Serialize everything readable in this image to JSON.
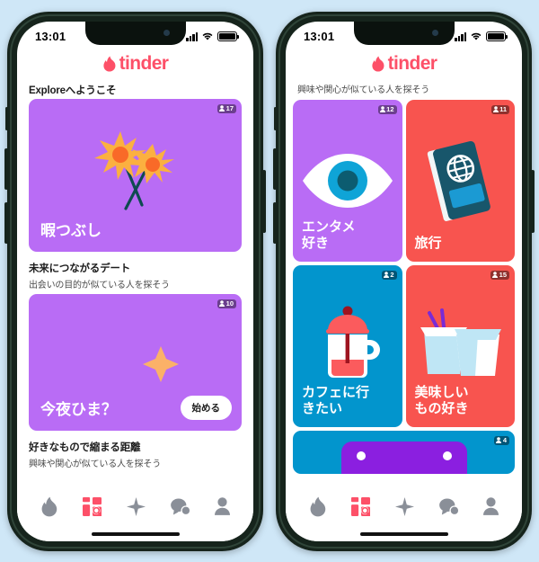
{
  "app": {
    "brand_name": "tinder",
    "brand_color": "#FD5068",
    "flame_icon": "flame-icon"
  },
  "colors": {
    "purple": "#B96CF5",
    "red": "#F8544F",
    "blue": "#0295CD",
    "page_background": "#cfe7f7",
    "active_tab": "#FD5068",
    "inactive_tab": "#8a8f98"
  },
  "status_bar": {
    "time": "13:01",
    "signal_icon": "cellular-signal-icon",
    "wifi_icon": "wifi-icon",
    "battery_icon": "battery-icon"
  },
  "tab_bar": {
    "items": [
      {
        "name": "flame-icon",
        "label": "Discover",
        "active": false
      },
      {
        "name": "explore-icon",
        "label": "Explore",
        "active": true
      },
      {
        "name": "sparkle-icon",
        "label": "Likes",
        "active": false
      },
      {
        "name": "chat-icon",
        "label": "Messages",
        "active": false
      },
      {
        "name": "profile-icon",
        "label": "Profile",
        "active": false
      }
    ]
  },
  "phone_left": {
    "sections": [
      {
        "title": "Exploreへようこそ",
        "subtitle": ""
      },
      {
        "title": "未来につながるデート",
        "subtitle": "出会いの目的が似ている人を探そう"
      },
      {
        "title": "好きなもので縮まる距離",
        "subtitle": "興味や関心が似ている人を探そう"
      }
    ],
    "cards": [
      {
        "label": "暇つぶし",
        "badge_count": "17",
        "badge_icon": "person-icon",
        "color": "#B96CF5",
        "art": "sparklers-illustration"
      },
      {
        "label": "今夜ひま？",
        "badge_count": "10",
        "badge_icon": "person-icon",
        "color": "#B96CF5",
        "art": "moon-star-illustration",
        "button_label": "始める"
      }
    ]
  },
  "phone_right": {
    "subtitle": "興味や関心が似ている人を探そう",
    "cards": [
      {
        "label": "エンタメ\n好き",
        "label_lines": [
          "エンタメ",
          "好き"
        ],
        "badge_count": "12",
        "badge_icon": "person-icon",
        "color": "#B96CF5",
        "art": "eye-illustration"
      },
      {
        "label": "旅行",
        "label_lines": [
          "旅行"
        ],
        "badge_count": "11",
        "badge_icon": "person-icon",
        "color": "#F8544F",
        "art": "passport-illustration"
      },
      {
        "label": "カフェに行\nきたい",
        "label_lines": [
          "カフェに行",
          "きたい"
        ],
        "badge_count": "2",
        "badge_icon": "person-icon",
        "color": "#0295CD",
        "art": "french-press-illustration"
      },
      {
        "label": "美味しい\nもの好き",
        "label_lines": [
          "美味しい",
          "もの好き"
        ],
        "badge_count": "15",
        "badge_icon": "person-icon",
        "color": "#F8544F",
        "art": "takeout-boxes-illustration"
      }
    ],
    "partial_card": {
      "badge_count": "4",
      "badge_icon": "person-icon",
      "color": "#0295CD",
      "art": "game-controller-illustration"
    }
  }
}
